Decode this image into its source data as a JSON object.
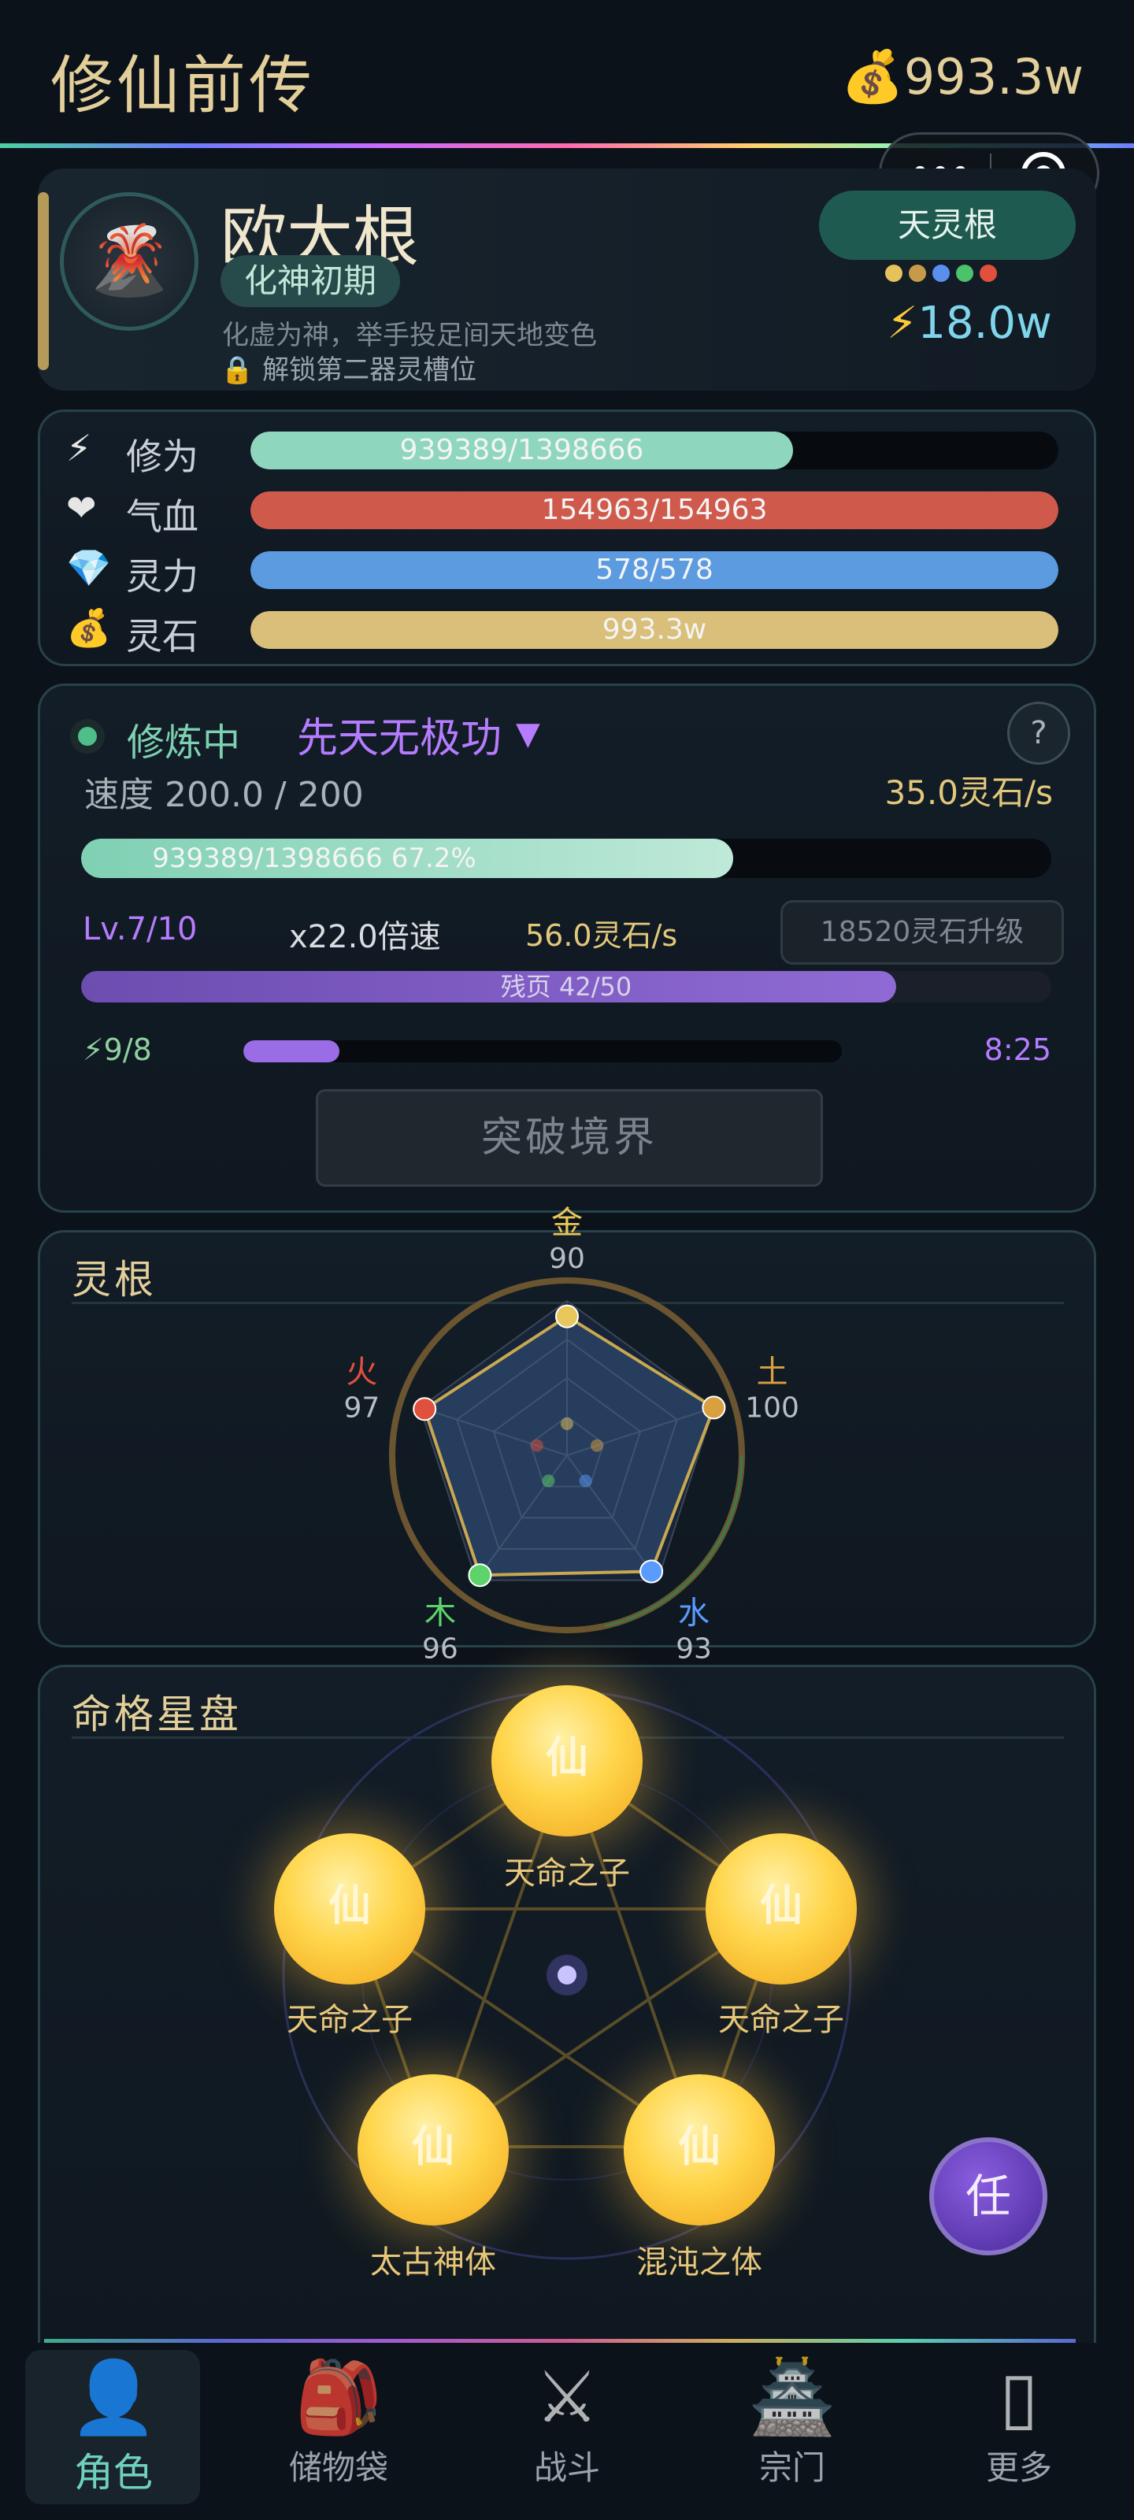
{
  "header": {
    "title": "修仙前传",
    "currency": "993.3w",
    "capsule": {
      "more": "•••"
    }
  },
  "profile": {
    "name": "欧大根",
    "realm": "化神初期",
    "desc": "化虚为神，举手投足间天地变色",
    "unlock": "解锁第二器灵槽位",
    "root_badge": "天灵根",
    "power": "18.0w",
    "root_dots": [
      "#e6c25a",
      "#c79a4a",
      "#5a8ff0",
      "#4cc26a",
      "#e0503c"
    ]
  },
  "stats": [
    {
      "icon": "⚡",
      "label": "修为",
      "text": "939389/1398666",
      "fraction": 0.6716,
      "color": "#8fd6bf"
    },
    {
      "icon": "❤",
      "label": "气血",
      "text": "154963/154963",
      "fraction": 1.0,
      "color": "#cf5a4c"
    },
    {
      "icon": "💎",
      "label": "灵力",
      "text": "578/578",
      "fraction": 1.0,
      "color": "#5c9be0"
    },
    {
      "icon": "💰",
      "label": "灵石",
      "text": "993.3w",
      "fraction": 1.0,
      "color": "#d9bf7a"
    }
  ],
  "cultivation": {
    "status": "修炼中",
    "method": "先天无极功",
    "dropdown": "▼",
    "help": "?",
    "speed": "速度 200.0 / 200",
    "rate": "35.0灵石/s",
    "progress_text": "939389/1398666  67.2%",
    "progress_fraction": 0.672,
    "level": "Lv.7/10",
    "multiplier": "x22.0倍速",
    "cost_rate": "56.0灵石/s",
    "upgrade_button": "18520灵石升级",
    "pages_text": "残页 42/50",
    "pages_fraction": 0.84,
    "energy": "⚡9/8",
    "energy_fraction": 0.16,
    "timer": "8:25",
    "breakthrough_button": "突破境界"
  },
  "spirit_root": {
    "title": "灵根",
    "elements": [
      {
        "name": "金",
        "value": "90",
        "color": "#e8c85a"
      },
      {
        "name": "土",
        "value": "100",
        "color": "#d9a040"
      },
      {
        "name": "水",
        "value": "93",
        "color": "#5a9bff"
      },
      {
        "name": "木",
        "value": "96",
        "color": "#5ed36a"
      },
      {
        "name": "火",
        "value": "97",
        "color": "#e0503c"
      }
    ],
    "max": 100
  },
  "fate": {
    "title": "命格星盘",
    "orb_glyph": "仙",
    "orbs": [
      {
        "label": "天命之子"
      },
      {
        "label": "天命之子"
      },
      {
        "label": "天命之子"
      },
      {
        "label": "太古神体"
      },
      {
        "label": "混沌之体"
      }
    ],
    "task_button": "任"
  },
  "nav": [
    {
      "icon": "👤",
      "label": "角色",
      "active": true
    },
    {
      "icon": "🎒",
      "label": "储物袋",
      "active": false
    },
    {
      "icon": "⚔",
      "label": "战斗",
      "active": false
    },
    {
      "icon": "🏯",
      "label": "宗门",
      "active": false
    },
    {
      "icon": "▯",
      "label": "更多",
      "active": false
    }
  ]
}
